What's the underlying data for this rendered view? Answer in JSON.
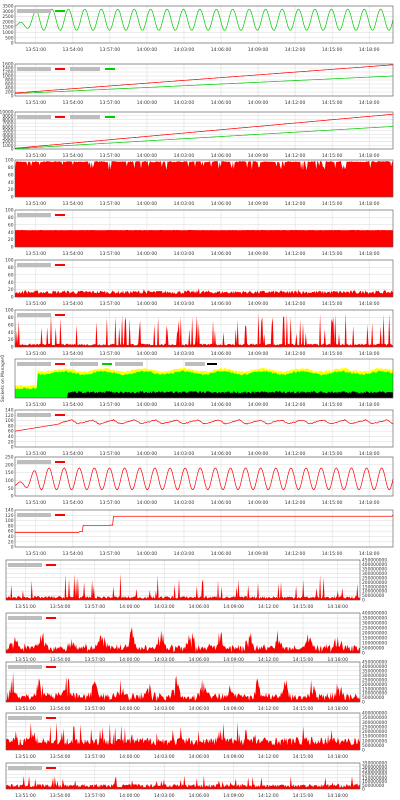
{
  "colors": {
    "frame": "#555555",
    "grid": "#d9d9d9",
    "tick_text": "#333333",
    "legend_bar": "#bdbdbd",
    "red": "#ff0000",
    "green": "#00cc00",
    "bright_green": "#00ff00",
    "yellow": "#ffff00",
    "black": "#000000"
  },
  "time_axis": {
    "labels": [
      "13:51:00",
      "13:54:00",
      "13:57:00",
      "14:00:00",
      "14:03:00",
      "14:06:00",
      "14:09:00",
      "14:12:00",
      "14:15:00",
      "14:18:00"
    ]
  },
  "panels": [
    {
      "id": "p1",
      "chart_data": {
        "type": "line",
        "legend": "gray bar top-left",
        "grid": true,
        "y_ticks": [
          "0",
          "500",
          "1000",
          "1500",
          "2000",
          "2500",
          "3000",
          "3500"
        ],
        "ylim": [
          0,
          3500
        ],
        "series": [
          {
            "color": "green",
            "kind": "sine",
            "base": 2200,
            "amp": 1000,
            "periods": 23
          }
        ]
      }
    },
    {
      "id": "p2",
      "chart_data": {
        "type": "line",
        "legend": "gray bar top-left",
        "grid": true,
        "y_ticks": [
          "0",
          "200",
          "400",
          "600",
          "800",
          "1000",
          "1200",
          "1400",
          "1600"
        ],
        "ylim": [
          0,
          1600
        ],
        "series": [
          {
            "color": "red",
            "kind": "ramp",
            "start": 150,
            "end": 1560
          },
          {
            "color": "green",
            "kind": "ramp",
            "start": 120,
            "end": 1000
          }
        ]
      }
    },
    {
      "id": "p3",
      "chart_data": {
        "type": "line",
        "legend": "gray bar top-left",
        "grid": true,
        "y_ticks": [
          "0",
          "1000",
          "2000",
          "3000",
          "4000",
          "5000",
          "6000",
          "7000",
          "8000",
          "9000",
          "10000"
        ],
        "ylim": [
          0,
          10000
        ],
        "series": [
          {
            "color": "red",
            "kind": "ramp",
            "start": 200,
            "end": 9400
          },
          {
            "color": "green",
            "kind": "ramp",
            "start": 100,
            "end": 6100
          }
        ]
      }
    },
    {
      "id": "p4",
      "chart_data": {
        "type": "area",
        "grid": true,
        "y_ticks": [
          "0",
          "20",
          "40",
          "60",
          "80",
          "100"
        ],
        "ylim": [
          0,
          100
        ],
        "series": [
          {
            "color": "red",
            "kind": "fill",
            "level": 97,
            "jitter": 3,
            "dips": 60,
            "dipdepth": 25
          }
        ]
      }
    },
    {
      "id": "p5",
      "chart_data": {
        "type": "area",
        "legend": "gray bar top-left",
        "grid": true,
        "y_ticks": [
          "0",
          "20",
          "40",
          "60",
          "80",
          "100"
        ],
        "ylim": [
          0,
          100
        ],
        "series": [
          {
            "color": "red",
            "kind": "fill",
            "level": 46,
            "jitter": 1,
            "dips": 0,
            "dipdepth": 0
          }
        ]
      }
    },
    {
      "id": "p6",
      "chart_data": {
        "type": "area",
        "legend": "gray bar top-left",
        "grid": true,
        "y_ticks": [
          "0",
          "20",
          "40",
          "60",
          "80",
          "100"
        ],
        "ylim": [
          0,
          100
        ],
        "series": [
          {
            "color": "red",
            "kind": "noise",
            "level": 8,
            "jitter": 10,
            "spikes": 10,
            "spikeh": 25
          }
        ]
      }
    },
    {
      "id": "p7",
      "chart_data": {
        "type": "area",
        "legend": "gray bar top-left",
        "grid": true,
        "y_ticks": [
          "0",
          "20",
          "40",
          "60",
          "80",
          "100"
        ],
        "ylim": [
          0,
          100
        ],
        "series": [
          {
            "color": "red",
            "kind": "noise",
            "level": 4,
            "jitter": 5,
            "spikes": 70,
            "spikeh": 95
          }
        ]
      }
    },
    {
      "id": "p8",
      "chart_data": {
        "type": "area",
        "legend": "gray bar top-left",
        "grid": true,
        "ylabel": "Sockets on Manager0",
        "y_ticks": [],
        "ylim": [
          0,
          1
        ],
        "series": [
          {
            "kind": "stacked_sockets"
          }
        ]
      }
    },
    {
      "id": "p9",
      "chart_data": {
        "type": "line",
        "legend": "gray bar top-left",
        "grid": true,
        "y_ticks": [
          "0",
          "20",
          "40",
          "60",
          "80",
          "100",
          "120",
          "140"
        ],
        "ylim": [
          0,
          140
        ],
        "series": [
          {
            "color": "red",
            "kind": "wavy_step",
            "start": 60,
            "step_at": 0.12,
            "base": 95,
            "amp": 15,
            "periods": 18
          }
        ]
      }
    },
    {
      "id": "p10",
      "chart_data": {
        "type": "line",
        "legend": "gray bar top-left",
        "grid": true,
        "y_ticks": [
          "0",
          "50",
          "100",
          "150",
          "200",
          "250"
        ],
        "ylim": [
          0,
          250
        ],
        "series": [
          {
            "color": "red",
            "kind": "sine",
            "base": 110,
            "amp": 70,
            "periods": 25
          }
        ]
      }
    },
    {
      "id": "p11",
      "chart_data": {
        "type": "line",
        "legend": "gray bar top-left",
        "grid": true,
        "y_ticks": [
          "0",
          "20",
          "40",
          "60",
          "80",
          "100",
          "120",
          "140"
        ],
        "ylim": [
          0,
          140
        ],
        "series": [
          {
            "color": "red",
            "kind": "steps",
            "points": [
              [
                0,
                55
              ],
              [
                0.17,
                58
              ],
              [
                0.18,
                82
              ],
              [
                0.25,
                83
              ],
              [
                0.26,
                116
              ],
              [
                1,
                122
              ]
            ]
          }
        ]
      }
    },
    {
      "id": "p12",
      "chart_data": {
        "type": "area",
        "legend": "gray bar top-left",
        "grid": true,
        "y_axis_side": "right",
        "y_ticks": [
          "0",
          "50000000",
          "100000000",
          "150000000",
          "200000000",
          "250000000",
          "300000000",
          "350000000",
          "400000000",
          "450000000"
        ],
        "ylim": [
          0,
          450000000
        ],
        "series": [
          {
            "color": "red",
            "kind": "noise",
            "level": 15000000,
            "jitter": 30000000,
            "spikes": 40,
            "spikeh": 300000000
          }
        ]
      }
    },
    {
      "id": "p13",
      "chart_data": {
        "type": "area",
        "legend": "gray bar top-left",
        "grid": true,
        "y_axis_side": "right",
        "y_ticks": [
          "0",
          "50000000",
          "100000000",
          "150000000",
          "200000000",
          "250000000",
          "300000000",
          "350000000",
          "400000000"
        ],
        "ylim": [
          0,
          400000000
        ],
        "series": [
          {
            "color": "red",
            "kind": "noise_periodic",
            "level": 40000000,
            "jitter": 60000000,
            "periods": 24,
            "peak": 200000000
          }
        ]
      }
    },
    {
      "id": "p14",
      "chart_data": {
        "type": "area",
        "legend": "gray bar top-left",
        "grid": true,
        "y_axis_side": "right",
        "y_ticks": [
          "0",
          "50000000",
          "100000000",
          "150000000",
          "200000000",
          "250000000",
          "300000000",
          "350000000",
          "400000000",
          "450000000"
        ],
        "ylim": [
          0,
          450000000
        ],
        "series": [
          {
            "color": "red",
            "kind": "noise_periodic",
            "level": 60000000,
            "jitter": 60000000,
            "periods": 26,
            "peak": 250000000
          }
        ]
      }
    },
    {
      "id": "p15",
      "chart_data": {
        "type": "area",
        "legend": "gray bar top-left",
        "grid": true,
        "y_axis_side": "right",
        "y_ticks": [
          "0",
          "50000000",
          "100000000",
          "150000000",
          "200000000",
          "250000000",
          "300000000",
          "350000000",
          "400000000"
        ],
        "ylim": [
          0,
          400000000
        ],
        "series": [
          {
            "color": "red",
            "kind": "noise",
            "level": 50000000,
            "jitter": 90000000,
            "spikes": 60,
            "spikeh": 300000000
          }
        ]
      }
    },
    {
      "id": "p16",
      "chart_data": {
        "type": "area",
        "legend": "gray bar top-left",
        "grid": true,
        "y_axis_side": "right",
        "y_ticks": [
          "0",
          "50000000",
          "100000000",
          "150000000",
          "200000000",
          "250000000",
          "300000000",
          "350000000"
        ],
        "ylim": [
          0,
          350000000
        ],
        "series": [
          {
            "color": "red",
            "kind": "noise",
            "level": 20000000,
            "jitter": 50000000,
            "spikes": 40,
            "spikeh": 180000000
          }
        ]
      }
    }
  ]
}
